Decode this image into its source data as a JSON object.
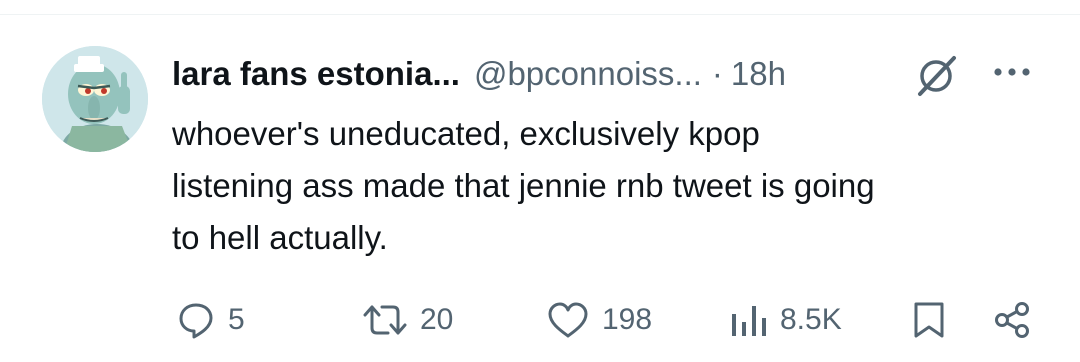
{
  "tweet": {
    "display_name": "lara fans estonia...",
    "handle": "@bpconnoiss...",
    "separator": "·",
    "time": "18h",
    "text": "whoever's uneducated, exclusively kpop\nlistening ass made that jennie rnb tweet is going\nto hell actually."
  },
  "actions": {
    "replies": "5",
    "retweets": "20",
    "likes": "198",
    "views": "8.5K"
  },
  "colors": {
    "text_primary": "#0f1419",
    "text_secondary": "#536471",
    "divider": "#eff3f4"
  },
  "icons": [
    "grok-icon",
    "more-icon",
    "reply-icon",
    "retweet-icon",
    "like-icon",
    "views-icon",
    "bookmark-icon",
    "share-icon"
  ]
}
